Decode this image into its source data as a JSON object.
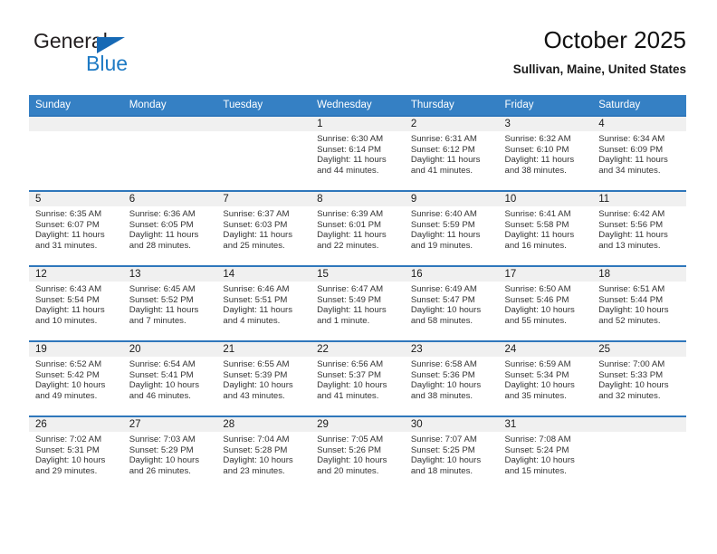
{
  "brand": {
    "name_top": "General",
    "name_bottom": "Blue",
    "accent_color": "#1e7ac4"
  },
  "header": {
    "title": "October 2025",
    "subtitle": "Sullivan, Maine, United States"
  },
  "theme": {
    "header_bg": "#3580c4",
    "row_divider": "#2f77bb",
    "daynum_band": "#f0f0f0"
  },
  "weekdays": [
    "Sunday",
    "Monday",
    "Tuesday",
    "Wednesday",
    "Thursday",
    "Friday",
    "Saturday"
  ],
  "labels": {
    "sunrise_prefix": "Sunrise:",
    "sunset_prefix": "Sunset:",
    "daylight_prefix": "Daylight:"
  },
  "weeks": [
    [
      {
        "day": "",
        "sunrise": "",
        "sunset": "",
        "daylight": ""
      },
      {
        "day": "",
        "sunrise": "",
        "sunset": "",
        "daylight": ""
      },
      {
        "day": "",
        "sunrise": "",
        "sunset": "",
        "daylight": ""
      },
      {
        "day": "1",
        "sunrise": "Sunrise: 6:30 AM",
        "sunset": "Sunset: 6:14 PM",
        "daylight": "Daylight: 11 hours and 44 minutes."
      },
      {
        "day": "2",
        "sunrise": "Sunrise: 6:31 AM",
        "sunset": "Sunset: 6:12 PM",
        "daylight": "Daylight: 11 hours and 41 minutes."
      },
      {
        "day": "3",
        "sunrise": "Sunrise: 6:32 AM",
        "sunset": "Sunset: 6:10 PM",
        "daylight": "Daylight: 11 hours and 38 minutes."
      },
      {
        "day": "4",
        "sunrise": "Sunrise: 6:34 AM",
        "sunset": "Sunset: 6:09 PM",
        "daylight": "Daylight: 11 hours and 34 minutes."
      }
    ],
    [
      {
        "day": "5",
        "sunrise": "Sunrise: 6:35 AM",
        "sunset": "Sunset: 6:07 PM",
        "daylight": "Daylight: 11 hours and 31 minutes."
      },
      {
        "day": "6",
        "sunrise": "Sunrise: 6:36 AM",
        "sunset": "Sunset: 6:05 PM",
        "daylight": "Daylight: 11 hours and 28 minutes."
      },
      {
        "day": "7",
        "sunrise": "Sunrise: 6:37 AM",
        "sunset": "Sunset: 6:03 PM",
        "daylight": "Daylight: 11 hours and 25 minutes."
      },
      {
        "day": "8",
        "sunrise": "Sunrise: 6:39 AM",
        "sunset": "Sunset: 6:01 PM",
        "daylight": "Daylight: 11 hours and 22 minutes."
      },
      {
        "day": "9",
        "sunrise": "Sunrise: 6:40 AM",
        "sunset": "Sunset: 5:59 PM",
        "daylight": "Daylight: 11 hours and 19 minutes."
      },
      {
        "day": "10",
        "sunrise": "Sunrise: 6:41 AM",
        "sunset": "Sunset: 5:58 PM",
        "daylight": "Daylight: 11 hours and 16 minutes."
      },
      {
        "day": "11",
        "sunrise": "Sunrise: 6:42 AM",
        "sunset": "Sunset: 5:56 PM",
        "daylight": "Daylight: 11 hours and 13 minutes."
      }
    ],
    [
      {
        "day": "12",
        "sunrise": "Sunrise: 6:43 AM",
        "sunset": "Sunset: 5:54 PM",
        "daylight": "Daylight: 11 hours and 10 minutes."
      },
      {
        "day": "13",
        "sunrise": "Sunrise: 6:45 AM",
        "sunset": "Sunset: 5:52 PM",
        "daylight": "Daylight: 11 hours and 7 minutes."
      },
      {
        "day": "14",
        "sunrise": "Sunrise: 6:46 AM",
        "sunset": "Sunset: 5:51 PM",
        "daylight": "Daylight: 11 hours and 4 minutes."
      },
      {
        "day": "15",
        "sunrise": "Sunrise: 6:47 AM",
        "sunset": "Sunset: 5:49 PM",
        "daylight": "Daylight: 11 hours and 1 minute."
      },
      {
        "day": "16",
        "sunrise": "Sunrise: 6:49 AM",
        "sunset": "Sunset: 5:47 PM",
        "daylight": "Daylight: 10 hours and 58 minutes."
      },
      {
        "day": "17",
        "sunrise": "Sunrise: 6:50 AM",
        "sunset": "Sunset: 5:46 PM",
        "daylight": "Daylight: 10 hours and 55 minutes."
      },
      {
        "day": "18",
        "sunrise": "Sunrise: 6:51 AM",
        "sunset": "Sunset: 5:44 PM",
        "daylight": "Daylight: 10 hours and 52 minutes."
      }
    ],
    [
      {
        "day": "19",
        "sunrise": "Sunrise: 6:52 AM",
        "sunset": "Sunset: 5:42 PM",
        "daylight": "Daylight: 10 hours and 49 minutes."
      },
      {
        "day": "20",
        "sunrise": "Sunrise: 6:54 AM",
        "sunset": "Sunset: 5:41 PM",
        "daylight": "Daylight: 10 hours and 46 minutes."
      },
      {
        "day": "21",
        "sunrise": "Sunrise: 6:55 AM",
        "sunset": "Sunset: 5:39 PM",
        "daylight": "Daylight: 10 hours and 43 minutes."
      },
      {
        "day": "22",
        "sunrise": "Sunrise: 6:56 AM",
        "sunset": "Sunset: 5:37 PM",
        "daylight": "Daylight: 10 hours and 41 minutes."
      },
      {
        "day": "23",
        "sunrise": "Sunrise: 6:58 AM",
        "sunset": "Sunset: 5:36 PM",
        "daylight": "Daylight: 10 hours and 38 minutes."
      },
      {
        "day": "24",
        "sunrise": "Sunrise: 6:59 AM",
        "sunset": "Sunset: 5:34 PM",
        "daylight": "Daylight: 10 hours and 35 minutes."
      },
      {
        "day": "25",
        "sunrise": "Sunrise: 7:00 AM",
        "sunset": "Sunset: 5:33 PM",
        "daylight": "Daylight: 10 hours and 32 minutes."
      }
    ],
    [
      {
        "day": "26",
        "sunrise": "Sunrise: 7:02 AM",
        "sunset": "Sunset: 5:31 PM",
        "daylight": "Daylight: 10 hours and 29 minutes."
      },
      {
        "day": "27",
        "sunrise": "Sunrise: 7:03 AM",
        "sunset": "Sunset: 5:29 PM",
        "daylight": "Daylight: 10 hours and 26 minutes."
      },
      {
        "day": "28",
        "sunrise": "Sunrise: 7:04 AM",
        "sunset": "Sunset: 5:28 PM",
        "daylight": "Daylight: 10 hours and 23 minutes."
      },
      {
        "day": "29",
        "sunrise": "Sunrise: 7:05 AM",
        "sunset": "Sunset: 5:26 PM",
        "daylight": "Daylight: 10 hours and 20 minutes."
      },
      {
        "day": "30",
        "sunrise": "Sunrise: 7:07 AM",
        "sunset": "Sunset: 5:25 PM",
        "daylight": "Daylight: 10 hours and 18 minutes."
      },
      {
        "day": "31",
        "sunrise": "Sunrise: 7:08 AM",
        "sunset": "Sunset: 5:24 PM",
        "daylight": "Daylight: 10 hours and 15 minutes."
      },
      {
        "day": "",
        "sunrise": "",
        "sunset": "",
        "daylight": ""
      }
    ]
  ]
}
